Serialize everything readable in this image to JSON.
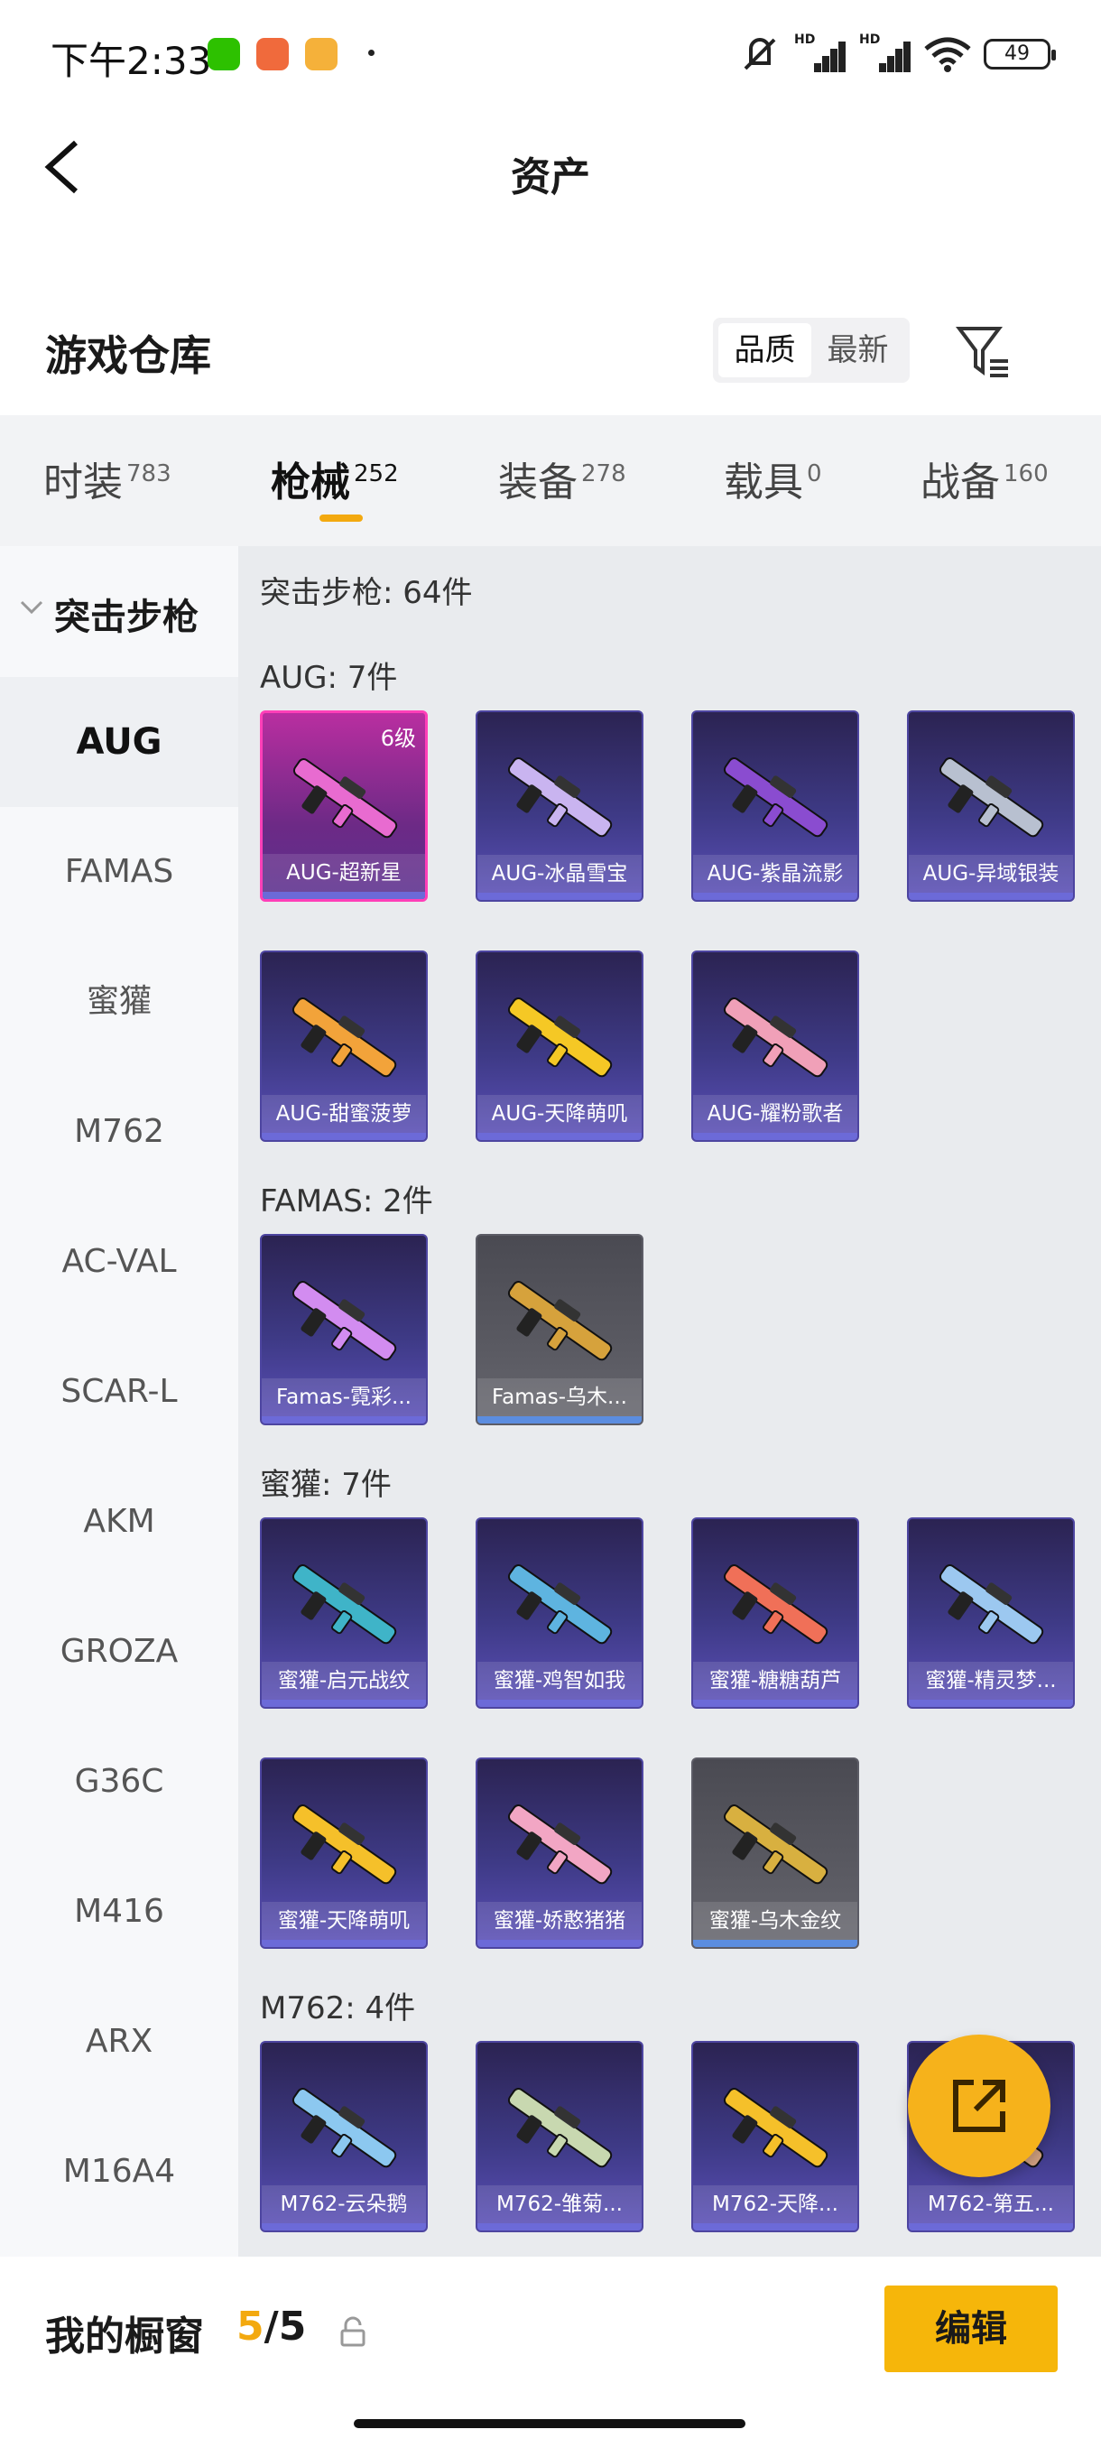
{
  "status_bar": {
    "time": "下午2:33",
    "battery": "49",
    "signal_hd": "HD",
    "colors": {
      "wechat": "#2dc100",
      "app2": "#f06a3c",
      "app3": "#f5b13a"
    }
  },
  "header": {
    "back_icon": "chevron-left-icon",
    "title": "资产"
  },
  "section": {
    "title": "游戏仓库",
    "sort_options": [
      "品质",
      "最新"
    ],
    "active_sort": "品质",
    "filter_icon": "filter-icon"
  },
  "tabs": [
    {
      "label": "时装",
      "count": "783"
    },
    {
      "label": "枪械",
      "count": "252",
      "active": true
    },
    {
      "label": "装备",
      "count": "278"
    },
    {
      "label": "载具",
      "count": "0"
    },
    {
      "label": "战备",
      "count": "160"
    }
  ],
  "sidebar": {
    "group": "突击步枪",
    "items": [
      "AUG",
      "FAMAS",
      "蜜獾",
      "M762",
      "AC-VAL",
      "SCAR-L",
      "AKM",
      "GROZA",
      "G36C",
      "M416",
      "ARX",
      "M16A4"
    ],
    "active": "AUG"
  },
  "content": {
    "category_header": "突击步枪: 64件",
    "groups": [
      {
        "title": "AUG: 7件",
        "items": [
          {
            "name": "AUG-超新星",
            "level": "6级",
            "style": "gold",
            "color": "#e86bd0"
          },
          {
            "name": "AUG-冰晶雪宝",
            "style": "purple",
            "color": "#c9b4f0"
          },
          {
            "name": "AUG-紫晶流影",
            "style": "purple",
            "color": "#8a4cd0"
          },
          {
            "name": "AUG-异域银装",
            "style": "purple",
            "color": "#b8c0d0"
          },
          {
            "name": "AUG-甜蜜菠萝",
            "style": "purple",
            "color": "#f2a33a"
          },
          {
            "name": "AUG-天降萌叽",
            "style": "purple",
            "color": "#f5c825"
          },
          {
            "name": "AUG-耀粉歌者",
            "style": "purple",
            "color": "#f0a0b8"
          }
        ]
      },
      {
        "title": "FAMAS: 2件",
        "items": [
          {
            "name": "Famas-霓彩...",
            "style": "purple",
            "color": "#d28cf0"
          },
          {
            "name": "Famas-乌木...",
            "style": "gray",
            "color": "#d6a23c"
          }
        ]
      },
      {
        "title": "蜜獾: 7件",
        "items": [
          {
            "name": "蜜獾-启元战纹",
            "style": "purple",
            "color": "#3fb4c8"
          },
          {
            "name": "蜜獾-鸡智如我",
            "style": "purple",
            "color": "#5eb4e0"
          },
          {
            "name": "蜜獾-糖糖葫芦",
            "style": "purple",
            "color": "#f07058"
          },
          {
            "name": "蜜獾-精灵梦...",
            "style": "purple",
            "color": "#9cc8f0"
          },
          {
            "name": "蜜獾-天降萌叽",
            "style": "purple",
            "color": "#f5c02a"
          },
          {
            "name": "蜜獾-娇憨猪猪",
            "style": "purple",
            "color": "#f2a6c4"
          },
          {
            "name": "蜜獾-乌木金纹",
            "style": "gray",
            "color": "#d8b040"
          }
        ]
      },
      {
        "title": "M762: 4件",
        "items": [
          {
            "name": "M762-云朵鹅",
            "style": "purple",
            "color": "#8cc8f0"
          },
          {
            "name": "M762-雏菊...",
            "style": "purple",
            "color": "#c8d8b0"
          },
          {
            "name": "M762-天降...",
            "style": "purple",
            "color": "#f5c02a"
          },
          {
            "name": "M762-第五...",
            "style": "purple",
            "color": "#d0a080"
          }
        ]
      }
    ]
  },
  "fab": {
    "icon": "share-external-icon",
    "color": "#f6b21b"
  },
  "bottom_bar": {
    "label": "我的橱窗",
    "count_current": "5",
    "count_total": "/5",
    "lock_icon": "lock-icon",
    "edit_label": "编辑",
    "accent": "#f3a90f"
  }
}
